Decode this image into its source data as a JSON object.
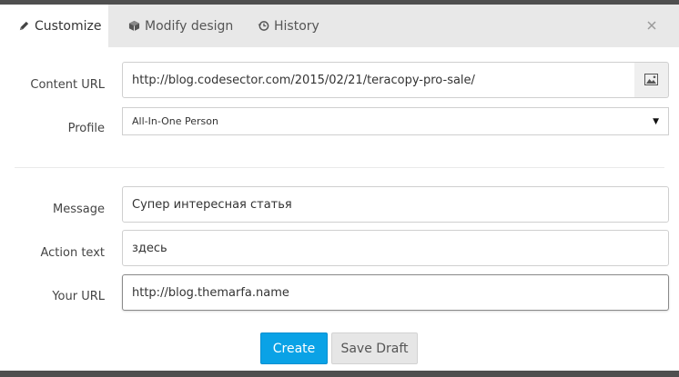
{
  "tabs": [
    {
      "label": "Customize",
      "icon": "pencil-icon",
      "active": true
    },
    {
      "label": "Modify design",
      "icon": "cube-icon",
      "active": false
    },
    {
      "label": "History",
      "icon": "history-icon",
      "active": false
    }
  ],
  "close_icon": "close-icon",
  "form": {
    "content_url": {
      "label": "Content URL",
      "value": "http://blog.codesector.com/2015/02/21/teracopy-pro-sale/"
    },
    "profile": {
      "label": "Profile",
      "value": "All-In-One Person"
    },
    "message": {
      "label": "Message",
      "value": "Супер интересная статья"
    },
    "action_text": {
      "label": "Action text",
      "value": "здесь"
    },
    "your_url": {
      "label": "Your URL",
      "value": "http://blog.themarfa.name"
    }
  },
  "buttons": {
    "create": "Create",
    "save_draft": "Save Draft"
  },
  "colors": {
    "accent": "#0aa2e6",
    "tabbar_bg": "#e8e8e8",
    "backdrop": "#4f4f4f"
  }
}
